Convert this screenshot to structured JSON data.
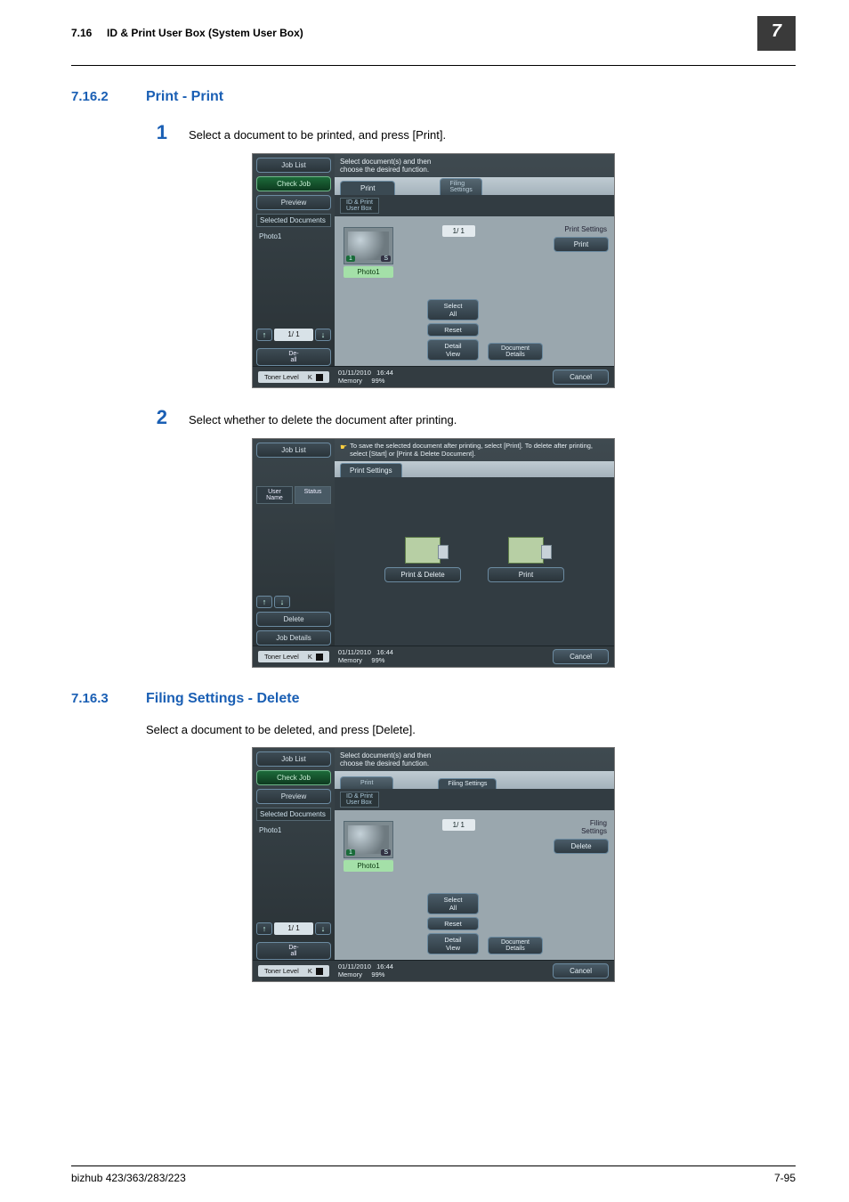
{
  "header": {
    "section_ref": "7.16",
    "section_title": "ID & Print User Box (System User Box)",
    "chapter_badge": "7"
  },
  "sec_a": {
    "num": "7.16.2",
    "title": "Print - Print"
  },
  "sec_b": {
    "num": "7.16.3",
    "title": "Filing Settings - Delete"
  },
  "steps": {
    "s1": {
      "n": "1",
      "text": "Select a document to be printed, and press [Print]."
    },
    "s2": {
      "n": "2",
      "text": "Select whether to delete the document after printing."
    }
  },
  "sec_b_text": "Select a document to be deleted, and press [Delete].",
  "ui": {
    "job_list": "Job List",
    "check_job": "Check Job",
    "preview": "Preview",
    "selected_docs": "Selected Documents",
    "photo1": "Photo1",
    "deall": "De-\nall",
    "page": "1/  1",
    "instr_select": "Select document(s) and then\nchoose the desired function.",
    "instr_save": "To save the selected document after printing, select [Print]. To delete after printing, select [Start] or [Print & Delete Document].",
    "tab_print": "Print",
    "tab_filing": "Filing\nSettings",
    "subtab_idprint": "ID & Print\nUser Box",
    "print_settings": "Print Settings",
    "print": "Print",
    "filing_settings": "Filing\nSettings",
    "delete": "Delete",
    "select_all": "Select\nAll",
    "reset": "Reset",
    "detail_view": "Detail\nView",
    "doc_details": "Document\nDetails",
    "cancel": "Cancel",
    "toner": "Toner Level",
    "toner_k": "K",
    "date": "01/11/2010",
    "time": "16:44",
    "mem_lbl": "Memory",
    "mem_pct": "99%",
    "inner_page": "1/  1",
    "user_name": "User\nName",
    "status": "Status",
    "delete_side": "Delete",
    "job_details": "Job Details",
    "print_delete": "Print & Delete",
    "thumb_badge_n": "1",
    "thumb_badge_s": "S"
  },
  "footer": {
    "left": "bizhub 423/363/283/223",
    "right": "7-95"
  }
}
